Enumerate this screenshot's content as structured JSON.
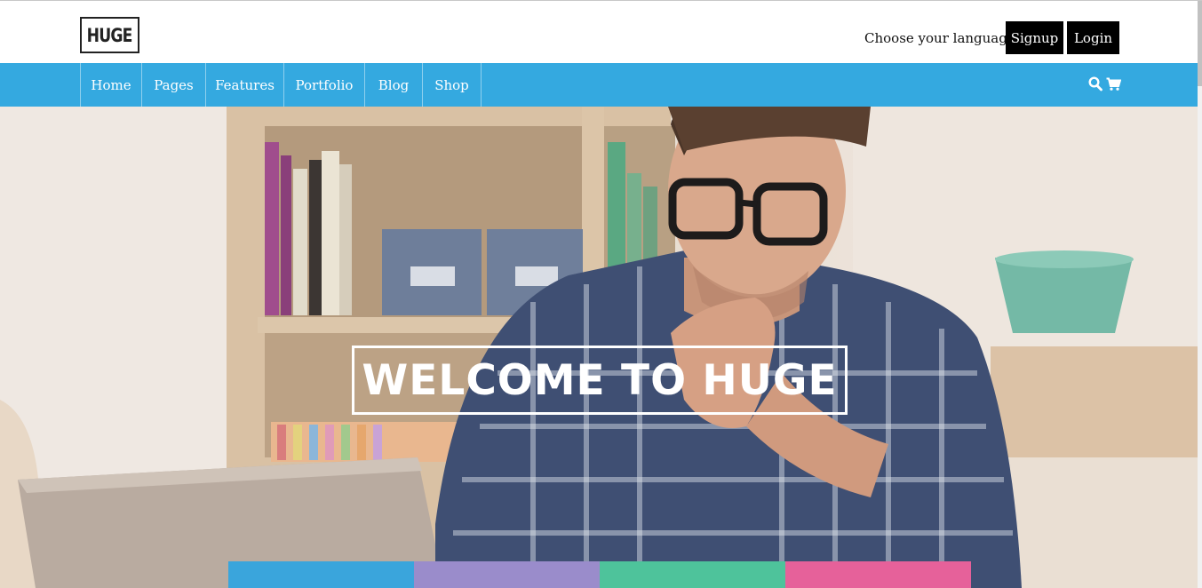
{
  "header": {
    "logo_text": "HUGE",
    "language_label": "Choose your language",
    "signup_label": "Signup",
    "login_label": "Login"
  },
  "nav": {
    "items": [
      {
        "label": "Home"
      },
      {
        "label": "Pages"
      },
      {
        "label": "Features"
      },
      {
        "label": "Portfolio"
      },
      {
        "label": "Blog"
      },
      {
        "label": "Shop"
      }
    ],
    "icons": [
      "search-icon",
      "cart-icon"
    ],
    "background": "#34a9e0"
  },
  "hero": {
    "title": "WELCOME TO HUGE",
    "tile_colors": [
      "#3aa5dc",
      "#9a8ccb",
      "#4ec39b",
      "#e6619a"
    ]
  }
}
